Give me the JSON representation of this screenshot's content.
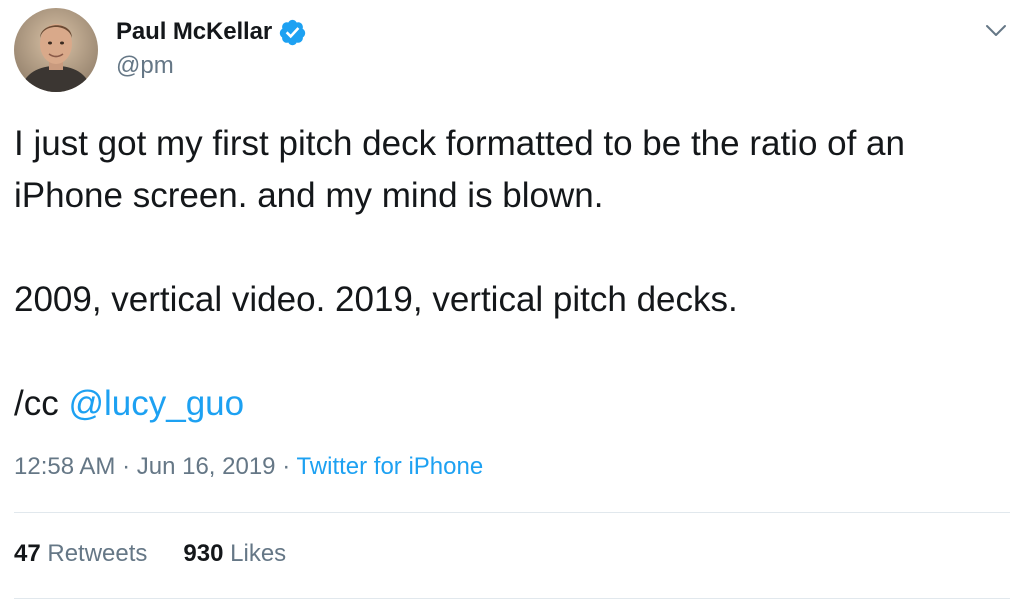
{
  "author": {
    "display_name": "Paul McKellar",
    "handle": "@pm",
    "verified": true,
    "avatar_icon": "user-avatar-photo"
  },
  "tweet": {
    "lines": [
      "I just got my first pitch deck formatted to be the ratio of an",
      "iPhone screen. and my mind is blown.",
      "",
      "2009, vertical video. 2019, vertical pitch decks.",
      ""
    ],
    "cc_prefix": "/cc ",
    "mention": "@lucy_guo"
  },
  "meta": {
    "time": "12:58 AM",
    "separator": " · ",
    "date": "Jun 16, 2019",
    "source": "Twitter for iPhone"
  },
  "stats": {
    "retweets_count": "47",
    "retweets_label": "Retweets",
    "likes_count": "930",
    "likes_label": "Likes"
  },
  "colors": {
    "link": "#1da1f2",
    "secondary_text": "#657786",
    "primary_text": "#14171a",
    "divider": "#e1e8ed",
    "verified_badge": "#1da1f2"
  }
}
